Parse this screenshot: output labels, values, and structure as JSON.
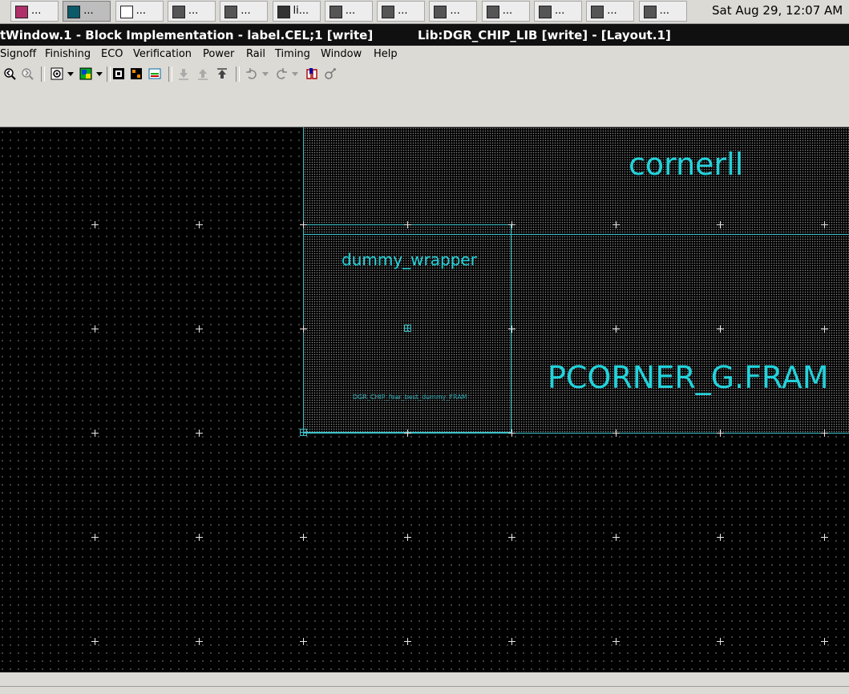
{
  "taskbar": {
    "tasks": [
      {
        "label": "...",
        "icon": "image-viewer-icon"
      },
      {
        "label": "...",
        "icon": "layout-tool-icon"
      },
      {
        "label": "...",
        "icon": "text-document-icon"
      },
      {
        "label": "...",
        "icon": "app-window-icon"
      },
      {
        "label": "...",
        "icon": "app-window-icon"
      },
      {
        "label": "li...",
        "icon": "terminal-icon"
      },
      {
        "label": "...",
        "icon": "app-window-icon"
      },
      {
        "label": "...",
        "icon": "app-window-icon"
      },
      {
        "label": "...",
        "icon": "app-window-icon"
      },
      {
        "label": "...",
        "icon": "app-window-icon"
      },
      {
        "label": "...",
        "icon": "app-window-icon"
      },
      {
        "label": "...",
        "icon": "app-window-icon"
      },
      {
        "label": "...",
        "icon": "app-window-icon"
      }
    ],
    "clock": "Sat Aug 29, 12:07 AM"
  },
  "window": {
    "title_left": "tWindow.1 - Block Implementation - label.CEL;1 [write]",
    "title_right": "Lib:DGR_CHIP_LIB [write] - [Layout.1]"
  },
  "menu": [
    "Signoff",
    "Finishing",
    "ECO",
    "Verification",
    "Power",
    "Rail",
    "Timing",
    "Window",
    "Help"
  ],
  "toolbar": {
    "icons": [
      "zoom-in-icon",
      "zoom-out-icon",
      "view-icon",
      "layer-icon",
      "cell-icon",
      "hierarchy-icon",
      "net-icon",
      "push-down-icon",
      "push-up-icon",
      "pop-top-icon",
      "undo-icon",
      "redo-icon",
      "book-icon",
      "settings-icon"
    ]
  },
  "canvas": {
    "labels": {
      "cornerll": "cornerll",
      "dummy_wrapper": "dummy_wrapper",
      "pcorner": "PCORNER_G.FRAM",
      "small": "DGR_CHIP_fear_best_dummy_FRAM"
    },
    "colors": {
      "cell_outline": "#3cc4cc",
      "label": "#22d3dc",
      "background": "#000000"
    }
  }
}
